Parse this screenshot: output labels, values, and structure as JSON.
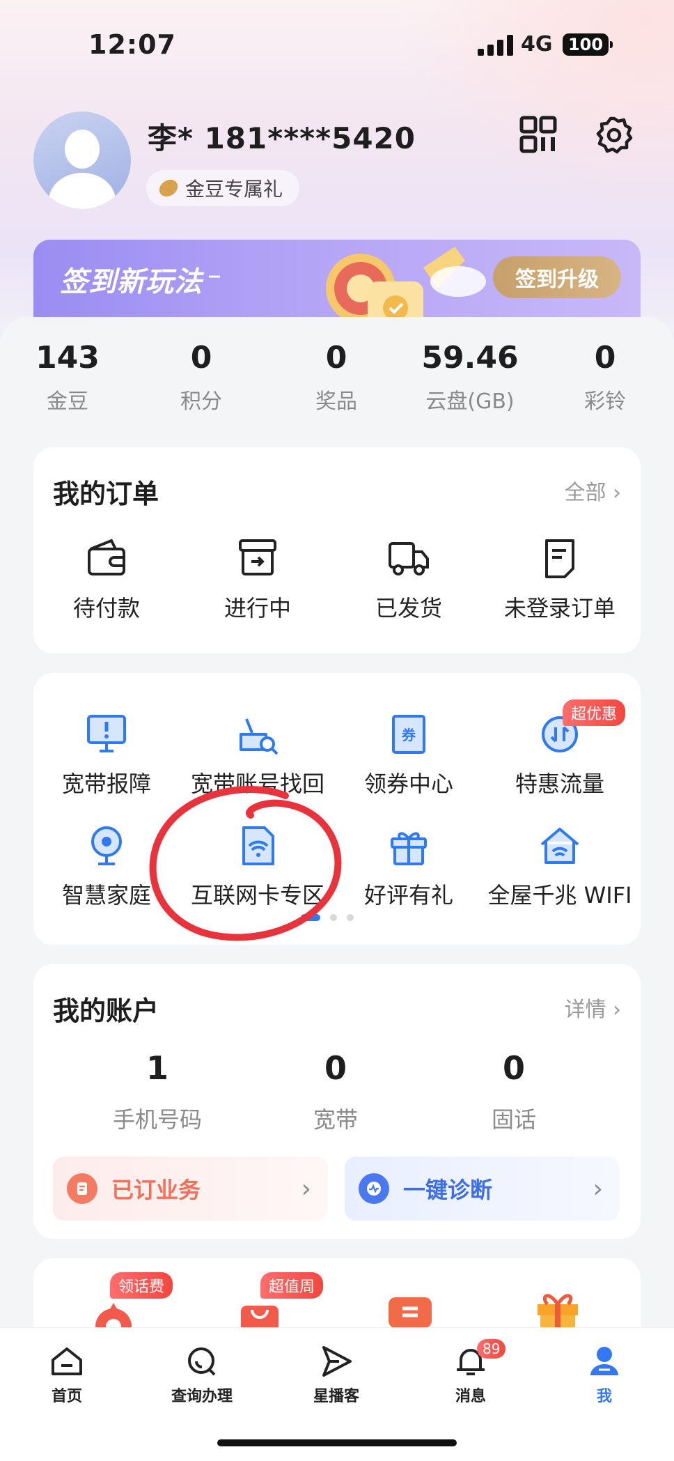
{
  "status_bar": {
    "time": "12:07",
    "network": "4G",
    "battery": "100"
  },
  "profile": {
    "name": "李* 181****5420",
    "gold_gift": "金豆专属礼"
  },
  "banner": {
    "title": "签到新玩法",
    "dash": "–",
    "button": "签到升级"
  },
  "stats": [
    {
      "value": "143",
      "label": "金豆"
    },
    {
      "value": "0",
      "label": "积分"
    },
    {
      "value": "0",
      "label": "奖品"
    },
    {
      "value": "59.46",
      "label": "云盘(GB)"
    },
    {
      "value": "0",
      "label": "彩铃"
    }
  ],
  "orders": {
    "title": "我的订单",
    "more": "全部 ›",
    "items": [
      {
        "label": "待付款",
        "icon": "wallet-icon"
      },
      {
        "label": "进行中",
        "icon": "box-icon"
      },
      {
        "label": "已发货",
        "icon": "truck-icon"
      },
      {
        "label": "未登录订单",
        "icon": "document-icon"
      }
    ]
  },
  "services": {
    "items": [
      {
        "label": "宽带报障",
        "icon": "monitor-alert-icon"
      },
      {
        "label": "宽带账号找回",
        "icon": "router-search-icon"
      },
      {
        "label": "领券中心",
        "icon": "coupon-icon"
      },
      {
        "label": "特惠流量",
        "icon": "traffic-icon",
        "badge": "超优惠"
      },
      {
        "label": "智慧家庭",
        "icon": "camera-icon"
      },
      {
        "label": "互联网卡专区",
        "icon": "sim-wifi-icon"
      },
      {
        "label": "好评有礼",
        "icon": "gift-icon"
      },
      {
        "label": "全屋千兆 WIFI",
        "icon": "home-wifi-icon"
      }
    ],
    "page_count": 3,
    "active_page": 1
  },
  "account": {
    "title": "我的账户",
    "more": "详情 ›",
    "items": [
      {
        "value": "1",
        "label": "手机号码"
      },
      {
        "value": "0",
        "label": "宽带"
      },
      {
        "value": "0",
        "label": "固话"
      }
    ],
    "subscribed": "已订业务",
    "diagnose": "一键诊断",
    "arrow": "›"
  },
  "promo_badges": {
    "left": "领话费",
    "right": "超值周"
  },
  "tabbar": [
    {
      "label": "首页",
      "icon": "home-icon"
    },
    {
      "label": "查询办理",
      "icon": "search-icon"
    },
    {
      "label": "星播客",
      "icon": "send-icon"
    },
    {
      "label": "消息",
      "icon": "bell-icon",
      "badge": "89"
    },
    {
      "label": "我",
      "icon": "user-icon",
      "active": true
    }
  ],
  "colors": {
    "accent": "#3478f6",
    "service_blue": "#2f7af2",
    "badge_red": "#f2473f",
    "banner_purple": "#9a8cf2",
    "gold": "#c7a06a"
  }
}
